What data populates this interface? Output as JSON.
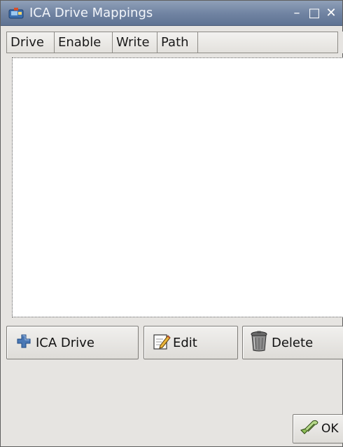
{
  "window": {
    "title": "ICA Drive Mappings",
    "icon": "network-drive-icon",
    "controls": {
      "minimize": "–",
      "maximize": "□",
      "close": "✕"
    }
  },
  "table": {
    "columns": [
      "Drive",
      "Enable",
      "Write",
      "Path"
    ],
    "rows": []
  },
  "buttons": {
    "add_label": "ICA Drive",
    "edit_label": "Edit",
    "delete_label": "Delete",
    "ok_label": "OK"
  },
  "colors": {
    "titlebar": "#6f82a1",
    "window_bg": "#e6e4e1",
    "list_bg": "#ffffff"
  }
}
